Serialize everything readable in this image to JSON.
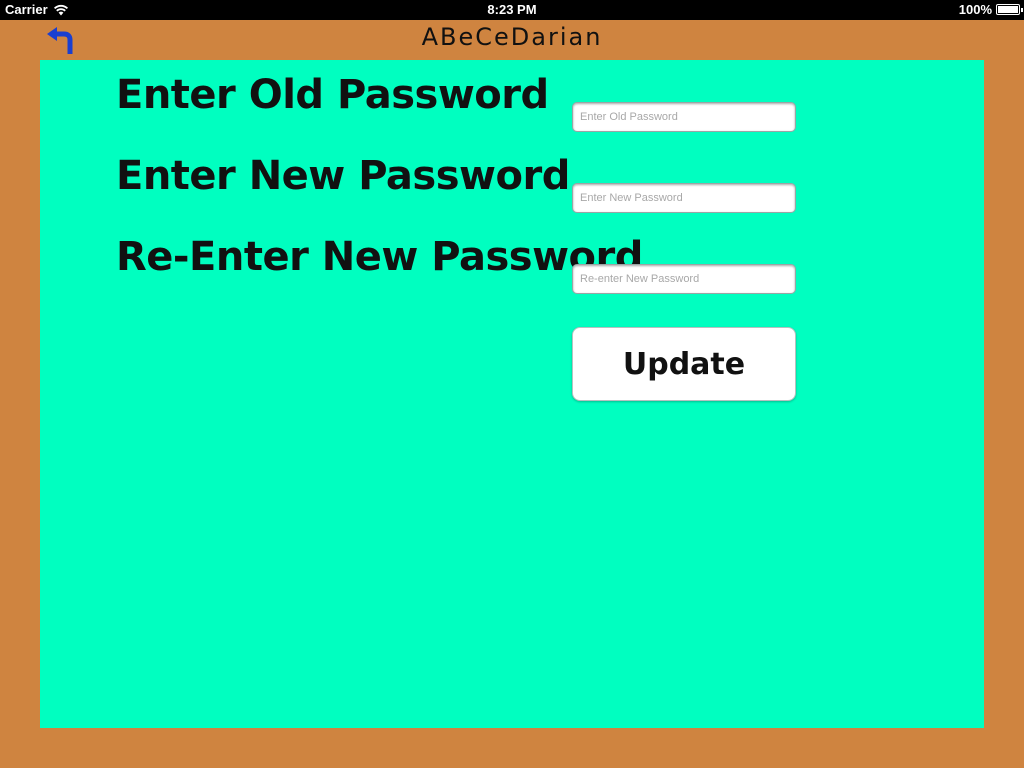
{
  "status_bar": {
    "carrier": "Carrier",
    "time": "8:23 PM",
    "battery": "100%",
    "wifi_icon": "wifi-icon",
    "battery_icon": "battery-icon"
  },
  "header": {
    "title": "ABeCeDarian",
    "back_icon": "back-arrow-icon"
  },
  "form": {
    "old_password": {
      "label": "Enter Old Password",
      "placeholder": "Enter Old Password",
      "value": ""
    },
    "new_password": {
      "label": "Enter New Password",
      "placeholder": "Enter New Password",
      "value": ""
    },
    "reenter_password": {
      "label": "Re-Enter New Password",
      "placeholder": "Re-enter New Password",
      "value": ""
    },
    "submit_label": "Update"
  },
  "colors": {
    "frame": "#cf8440",
    "panel": "#00ffc0",
    "back_icon": "#1a3fd0"
  }
}
